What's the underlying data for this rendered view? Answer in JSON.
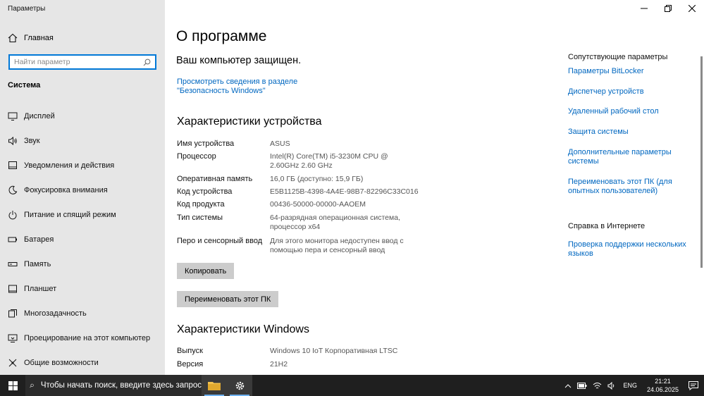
{
  "window": {
    "title": "Параметры"
  },
  "nav": {
    "home_label": "Главная",
    "search_placeholder": "Найти параметр",
    "section_label": "Система",
    "items": [
      {
        "label": "Дисплей",
        "icon": "display-icon"
      },
      {
        "label": "Звук",
        "icon": "speaker-icon"
      },
      {
        "label": "Уведомления и действия",
        "icon": "notifications-icon"
      },
      {
        "label": "Фокусировка внимания",
        "icon": "moon-icon"
      },
      {
        "label": "Питание и спящий режим",
        "icon": "power-icon"
      },
      {
        "label": "Батарея",
        "icon": "battery-icon"
      },
      {
        "label": "Память",
        "icon": "storage-icon"
      },
      {
        "label": "Планшет",
        "icon": "tablet-icon"
      },
      {
        "label": "Многозадачность",
        "icon": "multitasking-icon"
      },
      {
        "label": "Проецирование на этот компьютер",
        "icon": "projecting-icon"
      },
      {
        "label": "Общие возможности",
        "icon": "shared-experiences-icon"
      }
    ]
  },
  "main": {
    "title": "О программе",
    "protected_text": "Ваш компьютер защищен.",
    "security_link": "Просмотреть сведения в разделе \"Безопасность Windows\"",
    "device_specs_heading": "Характеристики устройства",
    "device_specs": [
      {
        "label": "Имя устройства",
        "value": "ASUS"
      },
      {
        "label": "Процессор",
        "value": "Intel(R) Core(TM) i5-3230M CPU @ 2.60GHz   2.60 GHz"
      },
      {
        "label": "Оперативная память",
        "value": "16,0 ГБ (доступно: 15,9 ГБ)"
      },
      {
        "label": "Код устройства",
        "value": "E5B1125B-4398-4A4E-98B7-82296C33C016"
      },
      {
        "label": "Код продукта",
        "value": "00436-50000-00000-AAOEM"
      },
      {
        "label": "Тип системы",
        "value": "64-разрядная операционная система, процессор x64"
      },
      {
        "label": "Перо и сенсорный ввод",
        "value": "Для этого монитора недоступен ввод с помощью пера и сенсорный ввод"
      }
    ],
    "copy_button": "Копировать",
    "rename_button": "Переименовать этот ПК",
    "windows_specs_heading": "Характеристики Windows",
    "windows_specs": [
      {
        "label": "Выпуск",
        "value": "Windows 10 IoT Корпоративная LTSC"
      },
      {
        "label": "Версия",
        "value": "21H2"
      }
    ]
  },
  "related": {
    "heading": "Сопутствующие параметры",
    "links": [
      "Параметры BitLocker",
      "Диспетчер устройств",
      "Удаленный рабочий стол",
      "Защита системы",
      "Дополнительные параметры системы",
      "Переименовать этот ПК (для опытных пользователей)"
    ],
    "help_heading": "Справка в Интернете",
    "help_links": [
      "Проверка поддержки нескольких языков"
    ]
  },
  "taskbar": {
    "search_text": "Чтобы начать поиск, введите здесь запрос",
    "lang": "ENG",
    "time": "21:21",
    "date": "24.06.2025"
  },
  "colors": {
    "accent": "#0078d7",
    "link": "#0067c0",
    "nav_bg": "#e6e6e6",
    "taskbar_bg": "#1f1f1f"
  }
}
